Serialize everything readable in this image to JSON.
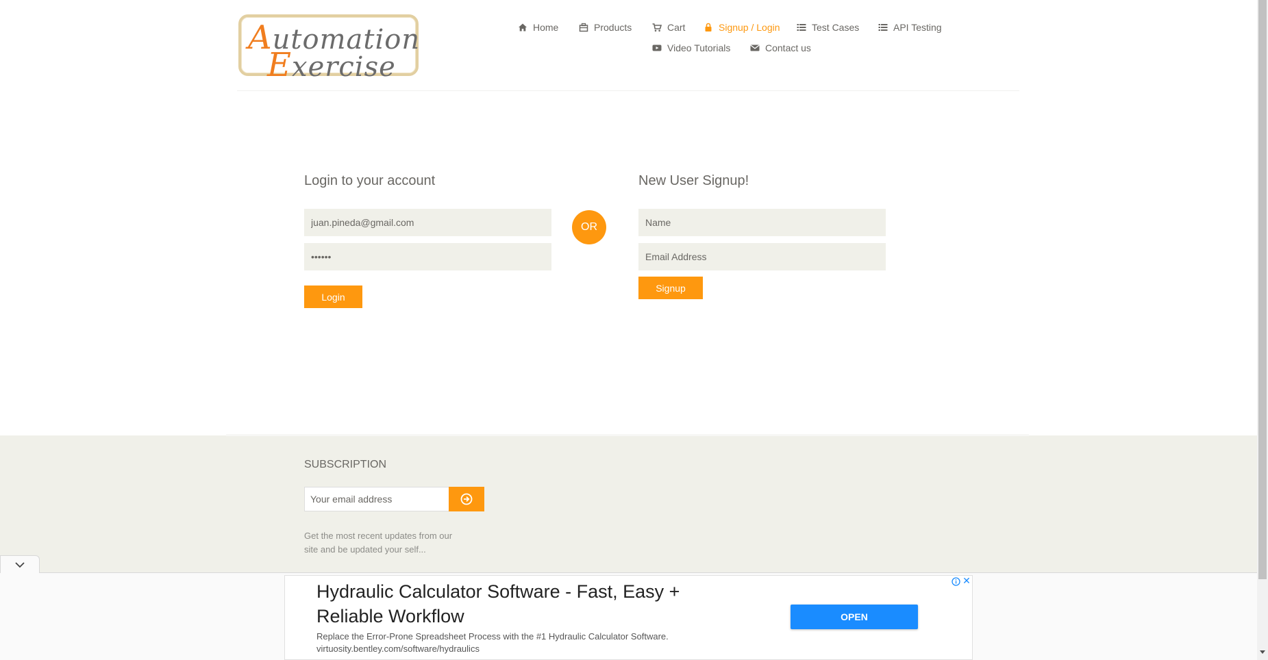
{
  "header": {
    "logo": {
      "line1_first": "A",
      "line1_rest": "utomation",
      "line2_first": "E",
      "line2_rest": "xercise"
    },
    "nav": [
      {
        "label": "Home",
        "icon": "home-icon"
      },
      {
        "label": "Products",
        "icon": "products-icon"
      },
      {
        "label": "Cart",
        "icon": "cart-icon"
      },
      {
        "label": "Signup / Login",
        "icon": "lock-icon",
        "active": true
      },
      {
        "label": "Test Cases",
        "icon": "list-icon"
      },
      {
        "label": "API Testing",
        "icon": "list-icon"
      },
      {
        "label": "Video Tutorials",
        "icon": "youtube-play-icon"
      },
      {
        "label": "Contact us",
        "icon": "envelope-icon"
      }
    ]
  },
  "login": {
    "title": "Login to your account",
    "email_value": "juan.pineda@gmail.com",
    "password_value": "••••••",
    "button_label": "Login"
  },
  "or_label": "OR",
  "signup": {
    "title": "New User Signup!",
    "name_placeholder": "Name",
    "email_placeholder": "Email Address",
    "button_label": "Signup"
  },
  "footer": {
    "subscription_title": "SUBSCRIPTION",
    "email_placeholder": "Your email address",
    "description": "Get the most recent updates from our site and be updated your self..."
  },
  "ad": {
    "title": "Hydraulic Calculator Software - Fast, Easy + Reliable Workflow",
    "description": "Replace the Error-Prone Spreadsheet Process with the #1 Hydraulic Calculator Software.",
    "url": "virtuosity.bentley.com/software/hydraulics",
    "open_label": "OPEN",
    "close_glyph": "✕"
  },
  "colors": {
    "accent": "#fe980f",
    "text": "#696763",
    "field_bg": "#f0f0e9",
    "ad_button": "#1a8cff"
  }
}
